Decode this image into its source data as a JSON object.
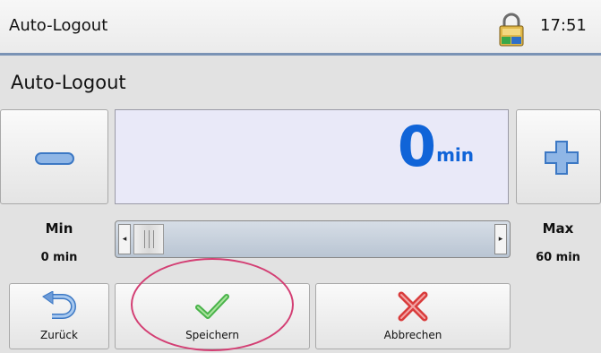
{
  "header": {
    "title": "Auto-Logout",
    "time": "17:51",
    "lock_icon": "padlock-icon"
  },
  "page": {
    "subtitle": "Auto-Logout"
  },
  "stepper": {
    "value": "0",
    "unit": "min",
    "decrement_icon": "minus-icon",
    "increment_icon": "plus-icon"
  },
  "range": {
    "min_label": "Min",
    "min_value": "0 min",
    "max_label": "Max",
    "max_value": "60 min",
    "slider_fraction": 0
  },
  "actions": {
    "back": {
      "label": "Zurück",
      "icon": "undo-arrow-icon"
    },
    "save": {
      "label": "Speichern",
      "icon": "checkmark-icon"
    },
    "cancel": {
      "label": "Abbrechen",
      "icon": "x-icon"
    }
  },
  "colors": {
    "accent": "#1064d8",
    "title_border": "#7a93b5",
    "highlight": "#d33e73"
  }
}
